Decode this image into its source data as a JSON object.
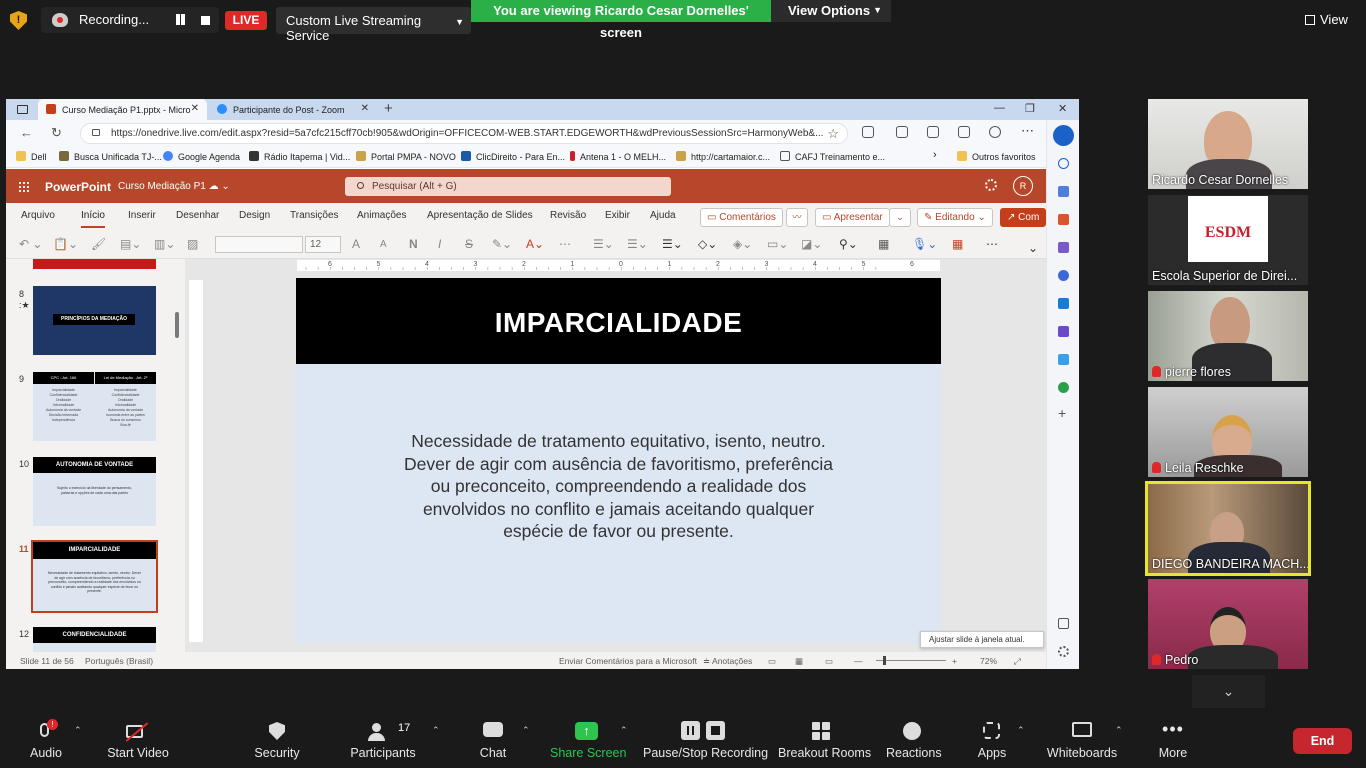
{
  "zoom_top": {
    "recording_label": "Recording...",
    "live_label": "LIVE",
    "stream_service": "Custom Live Streaming Service",
    "viewing_banner": "You are viewing Ricardo Cesar Dornelles' screen",
    "view_options": "View Options",
    "view_label": "View"
  },
  "browser": {
    "tabs": [
      {
        "label": "Curso Mediação P1.pptx - Micro"
      },
      {
        "label": "Participante do Post - Zoom"
      }
    ],
    "url": "https://onedrive.live.com/edit.aspx?resid=5a7cfc215cff70cb!905&wdOrigin=OFFICECOM-WEB.START.EDGEWORTH&wdPreviousSessionSrc=HarmonyWeb&...",
    "bookmarks": [
      "Dell",
      "Busca Unificada TJ-...",
      "Google Agenda",
      "Rádio Itapema | Vid...",
      "Portal PMPA - NOVO",
      "ClicDireito - Para En...",
      "Antena 1 - O MELH...",
      "http://cartamaior.c...",
      "CAFJ Treinamento e...",
      "Outros favoritos"
    ]
  },
  "ppt": {
    "app_name": "PowerPoint",
    "doc_name": "Curso Mediação P1",
    "search_placeholder": "Pesquisar (Alt + G)",
    "avatar_initial": "R",
    "ribbon_tabs": [
      "Arquivo",
      "Início",
      "Inserir",
      "Desenhar",
      "Design",
      "Transições",
      "Animações",
      "Apresentação de Slides",
      "Revisão",
      "Exibir",
      "Ajuda"
    ],
    "comments_btn": "Comentários",
    "present_btn": "Apresentar",
    "editing_btn": "Editando",
    "share_btn": "Com",
    "font_size": "12",
    "thumbnails": [
      {
        "num": "8",
        "title": "PRINCÍPIOS DA MEDIAÇÃO"
      },
      {
        "num": "9",
        "left_head": "CPC - Art. 166",
        "right_head": "Lei de Mediação - Art. 2º",
        "left_items": [
          "Imparcialidade",
          "Confidencialidade",
          "Oralidade",
          "Informalidade",
          "Autonomia da vontade",
          "Decisão informada",
          "Independência"
        ],
        "right_items": [
          "Imparcialidade",
          "Confidencialidade",
          "Oralidade",
          "Informalidade",
          "Autonomia da vontade",
          "Isonomia entre as partes",
          "Busca do consenso",
          "Boa-fé"
        ]
      },
      {
        "num": "10",
        "title": "AUTONOMIA DE VONTADE",
        "body": "Sujeito o exercício da liberdade do pensamento, palavras e opções de cada uma das partes"
      },
      {
        "num": "11",
        "title": "IMPARCIALIDADE",
        "body": "Necessidade de tratamento equitativo, isento, neutro. Dever de agir com ausência de favoritismo, preferência ou preconceito, compreendendo a realidade dos envolvidos no conflito e jamais aceitando qualquer espécie de favor ou presente."
      },
      {
        "num": "12",
        "title": "CONFIDENCIALIDADE"
      }
    ],
    "ruler_numbers": [
      "6",
      "5",
      "4",
      "3",
      "2",
      "1",
      "0",
      "1",
      "2",
      "3",
      "4",
      "5",
      "6"
    ],
    "slide": {
      "title": "IMPARCIALIDADE",
      "body_lines": [
        "Necessidade de tratamento equitativo, isento, neutro.",
        "Dever de agir com ausência de favoritismo, preferência",
        "ou preconceito, compreendendo a realidade dos",
        "envolvidos no conflito e jamais aceitando qualquer",
        "espécie de favor ou presente."
      ]
    },
    "status": {
      "slide_count": "Slide 11 de 56",
      "language": "Português (Brasil)",
      "feedback": "Enviar Comentários para a Microsoft",
      "notes": "Anotações",
      "zoom": "72%",
      "tooltip": "Ajustar slide à janela atual."
    }
  },
  "participants": [
    {
      "name": "Ricardo Cesar Dornelles",
      "muted": false
    },
    {
      "name": "Escola Superior de Direi...",
      "muted": false,
      "logo_text": "ESDM"
    },
    {
      "name": "pierre flores",
      "muted": true
    },
    {
      "name": "Leila Reschke",
      "muted": true
    },
    {
      "name": "DIEGO BANDEIRA MACH...",
      "muted": false,
      "speaking": true
    },
    {
      "name": "Pedro",
      "muted": true
    }
  ],
  "zoom_bottom": {
    "audio": "Audio",
    "start_video": "Start Video",
    "security": "Security",
    "participants": "Participants",
    "participants_count": "17",
    "chat": "Chat",
    "share_screen": "Share Screen",
    "pause_stop": "Pause/Stop Recording",
    "breakout": "Breakout Rooms",
    "reactions": "Reactions",
    "apps": "Apps",
    "whiteboards": "Whiteboards",
    "more": "More",
    "end": "End"
  },
  "colors": {
    "ppt_accent": "#b7472a",
    "zoom_green": "#2ab047",
    "live_red": "#e02828",
    "end_red": "#c6262e",
    "speaker_highlight": "#e6e62a"
  }
}
